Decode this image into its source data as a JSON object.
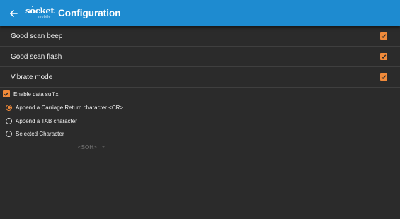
{
  "appbar": {
    "back_icon": "arrow-left-icon",
    "logo_text": "socket",
    "logo_subtext": "mobile",
    "title": "Configuration",
    "color": "#1e8bd0"
  },
  "preferences": [
    {
      "label": "Good scan beep",
      "checked": true
    },
    {
      "label": "Good scan flash",
      "checked": true
    },
    {
      "label": "Vibrate mode",
      "checked": true
    }
  ],
  "data_suffix": {
    "label": "Enable data suffix",
    "checked": true,
    "options": [
      {
        "label": "Append a Carriage Return character <CR>",
        "selected": true
      },
      {
        "label": "Append a TAB character",
        "selected": false
      },
      {
        "label": "Selected Character",
        "selected": false
      }
    ],
    "character_value": "<SOH>"
  },
  "colors": {
    "background": "#2b2b2b",
    "accent": "#f08a3a",
    "divider": "#3f3f3f"
  }
}
